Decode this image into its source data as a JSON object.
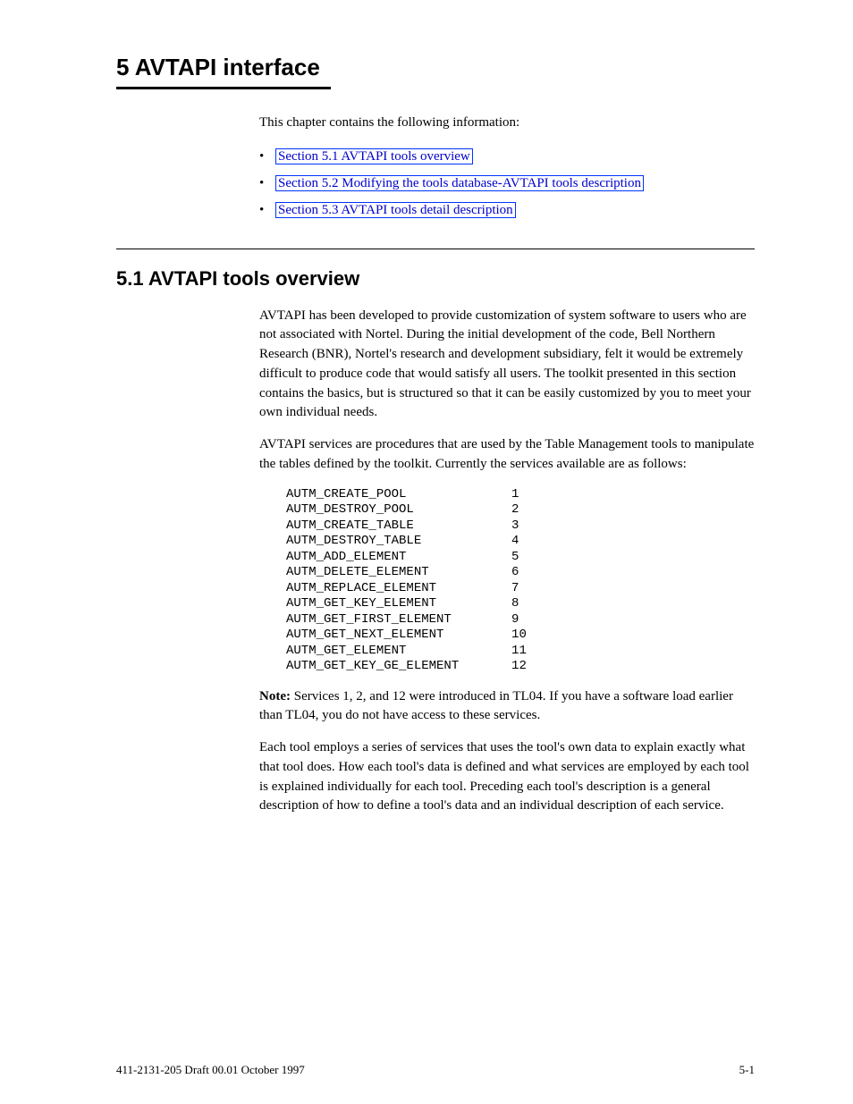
{
  "chapter": "5 AVTAPI interface",
  "intro": "This chapter contains the following information:",
  "links": [
    "Section 5.1 AVTAPI tools overview",
    "Section 5.2 Modifying the tools database-AVTAPI tools description",
    "Section 5.3 AVTAPI tools detail description"
  ],
  "section_title": "5.1 AVTAPI tools overview",
  "paragraphs": [
    "AVTAPI has been developed to provide customization of system software to users who are not associated with Nortel. During the initial development of the code, Bell Northern Research (BNR), Nortel's research and development subsidiary, felt it would be extremely difficult to produce code that would satisfy all users. The toolkit presented in this section contains the basics, but is structured so that it can be easily customized by you to meet your own individual needs.",
    "AVTAPI services are procedures that are used by the Table Management tools to manipulate the tables defined by the toolkit. Currently the services available are as follows:"
  ],
  "code_rows": [
    {
      "name": "AUTM_CREATE_POOL",
      "num": "1"
    },
    {
      "name": "AUTM_DESTROY_POOL",
      "num": "2"
    },
    {
      "name": "AUTM_CREATE_TABLE",
      "num": "3"
    },
    {
      "name": "AUTM_DESTROY_TABLE",
      "num": "4"
    },
    {
      "name": "AUTM_ADD_ELEMENT",
      "num": "5"
    },
    {
      "name": "AUTM_DELETE_ELEMENT",
      "num": "6"
    },
    {
      "name": "AUTM_REPLACE_ELEMENT",
      "num": "7"
    },
    {
      "name": "AUTM_GET_KEY_ELEMENT",
      "num": "8"
    },
    {
      "name": "AUTM_GET_FIRST_ELEMENT",
      "num": "9"
    },
    {
      "name": "AUTM_GET_NEXT_ELEMENT",
      "num": "10"
    },
    {
      "name": "AUTM_GET_ELEMENT",
      "num": "11"
    },
    {
      "name": "AUTM_GET_KEY_GE_ELEMENT",
      "num": "12"
    }
  ],
  "note": {
    "label": "Note:",
    "text": " Services 1, 2, and 12 were introduced in TL04. If you have a software load earlier than TL04, you do not have access to these services."
  },
  "after_note": "Each tool employs a series of services that uses the tool's own data to explain exactly what that tool does. How each tool's data is defined and what services are employed by each tool is explained individually for each tool. Preceding each tool's description is a general description of how to define a tool's data and an individual description of each service.",
  "footer": {
    "left": "411-2131-205  Draft 00.01  October 1997",
    "right": "5-1"
  }
}
